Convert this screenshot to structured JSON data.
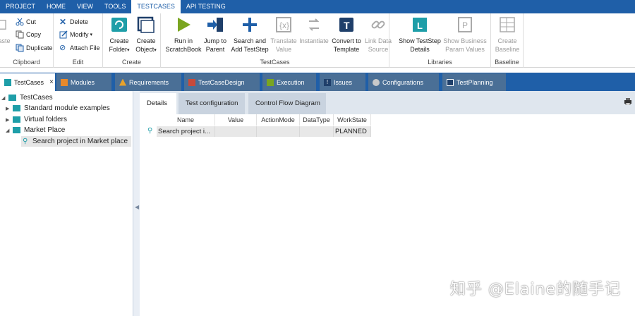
{
  "menu": {
    "items": [
      "PROJECT",
      "HOME",
      "VIEW",
      "TOOLS",
      "TESTCASES",
      "API TESTING"
    ]
  },
  "ribbon": {
    "clipboard": {
      "paste": "aste",
      "cut": "Cut",
      "copy": "Copy",
      "duplicate": "Duplicate",
      "label": "Clipboard"
    },
    "edit": {
      "delete": "Delete",
      "modify": "Modify",
      "attach": "Attach File",
      "label": "Edit"
    },
    "create": {
      "folder_l1": "Create",
      "folder_l2": "Folder",
      "object_l1": "Create",
      "object_l2": "Object",
      "label": "Create"
    },
    "testcases": {
      "run_l1": "Run in",
      "run_l2": "ScratchBook",
      "jump_l1": "Jump to",
      "jump_l2": "Parent",
      "search_l1": "Search and",
      "search_l2": "Add TestStep",
      "translate_l1": "Translate",
      "translate_l2": "Value",
      "instantiate": "Instantiate",
      "convert_l1": "Convert to",
      "convert_l2": "Template",
      "link_l1": "Link Data",
      "link_l2": "Source",
      "label": "TestCases"
    },
    "libraries": {
      "show_l1": "Show TestStep",
      "show_l2": "Details",
      "biz_l1": "Show Business",
      "biz_l2": "Param Values",
      "label": "Libraries"
    },
    "baseline": {
      "create_l1": "Create",
      "create_l2": "Baseline",
      "label": "Baseline"
    }
  },
  "tabs": {
    "testcases": "TestCases",
    "modules": "Modules",
    "requirements": "Requirements",
    "testcasedesign": "TestCaseDesign",
    "execution": "Execution",
    "issues": "Issues",
    "configurations": "Configurations",
    "testplanning": "TestPlanning",
    "close": "×"
  },
  "tree": {
    "root": "TestCases",
    "items": [
      "Standard module examples",
      "Virtual folders",
      "Market Place"
    ],
    "selected": "Search project in Market place"
  },
  "detail": {
    "tabs": [
      "Details",
      "Test configuration",
      "Control Flow Diagram"
    ],
    "columns": [
      "Name",
      "Value",
      "ActionMode",
      "DataType",
      "WorkState"
    ],
    "row": {
      "name": "Search project i...",
      "value": "",
      "actionmode": "",
      "datatype": "",
      "workstate": "PLANNED"
    }
  },
  "watermark": "知乎 @Elaine的随手记",
  "colors": {
    "menu_bg": "#1f5fa8",
    "accent_teal": "#1e9ea8",
    "tab_inactive": "#4a6f96"
  }
}
